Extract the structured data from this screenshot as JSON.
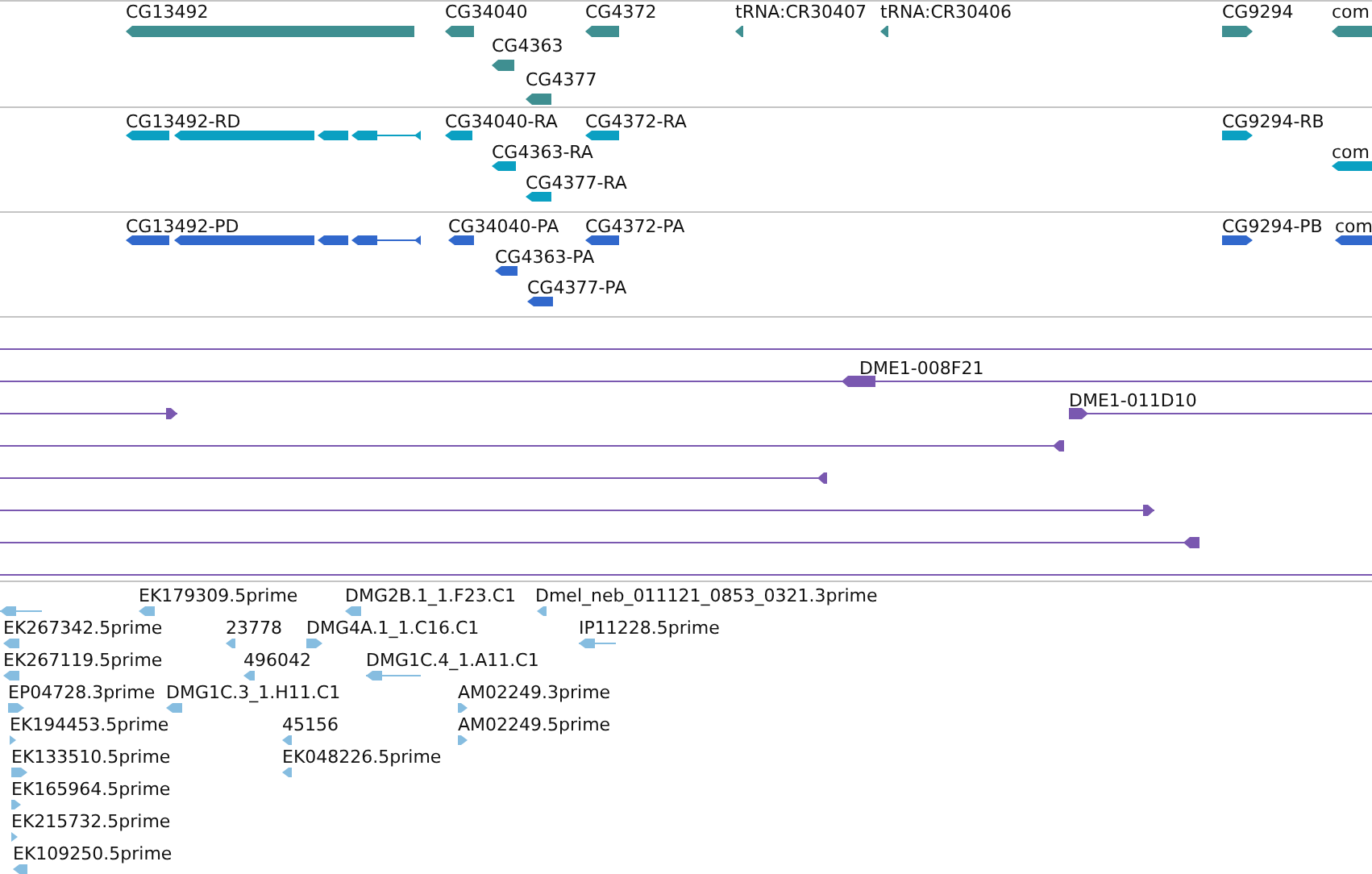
{
  "tracks": [
    {
      "kind": "gene",
      "color": "#3f8f91",
      "features": [
        {
          "label": "CG13492",
          "kind": "reverse"
        },
        {
          "label": "CG34040",
          "kind": "reverse"
        },
        {
          "label": "CG4363",
          "kind": "reverse"
        },
        {
          "label": "CG4372",
          "kind": "reverse"
        },
        {
          "label": "CG4377",
          "kind": "reverse"
        },
        {
          "label": "tRNA:CR30407",
          "kind": "reverse"
        },
        {
          "label": "tRNA:CR30406",
          "kind": "reverse"
        },
        {
          "label": "CG9294",
          "kind": "forward"
        },
        {
          "label": "com",
          "kind": "reverse"
        }
      ]
    },
    {
      "kind": "transcript",
      "color": "#0ba0c2",
      "features": [
        {
          "label": "CG13492-RD",
          "kind": "reverse"
        },
        {
          "label": "CG34040-RA",
          "kind": "reverse"
        },
        {
          "label": "CG4363-RA",
          "kind": "reverse"
        },
        {
          "label": "CG4372-RA",
          "kind": "reverse"
        },
        {
          "label": "CG4377-RA",
          "kind": "reverse"
        },
        {
          "label": "CG9294-RB",
          "kind": "forward"
        },
        {
          "label": "com",
          "kind": "reverse"
        }
      ]
    },
    {
      "kind": "transcript",
      "color": "#3168cc",
      "features": [
        {
          "label": "CG13492-PD",
          "kind": "reverse"
        },
        {
          "label": "CG34040-PA",
          "kind": "reverse"
        },
        {
          "label": "CG4363-PA",
          "kind": "reverse"
        },
        {
          "label": "CG4372-PA",
          "kind": "reverse"
        },
        {
          "label": "CG4377-PA",
          "kind": "reverse"
        },
        {
          "label": "CG9294-PB",
          "kind": "forward"
        },
        {
          "label": "com",
          "kind": "reverse"
        }
      ]
    },
    {
      "kind": "clone",
      "color": "#7a58b0",
      "features": [
        {
          "kind": "plain"
        },
        {
          "label": "DME1-008F21",
          "kind": "reverse"
        },
        {
          "kind": "forward"
        },
        {
          "label": "DME1-011D10",
          "kind": "forward"
        },
        {
          "kind": "reverse"
        },
        {
          "kind": "reverse"
        },
        {
          "kind": "forward"
        },
        {
          "kind": "reverse"
        },
        {
          "kind": "plain"
        }
      ]
    },
    {
      "kind": "est",
      "color": "#86bde0",
      "features": [
        {
          "kind": "reverse"
        },
        {
          "label": "EK179309.5prime",
          "kind": "reverse"
        },
        {
          "label": "DMG2B.1_1.F23.C1",
          "kind": "reverse"
        },
        {
          "label": "Dmel_neb_011121_0853_0321.3prime",
          "kind": "reverse"
        },
        {
          "label": "EK267342.5prime",
          "kind": "reverse"
        },
        {
          "label": "23778",
          "kind": "reverse"
        },
        {
          "label": "DMG4A.1_1.C16.C1",
          "kind": "forward"
        },
        {
          "label": "IP11228.5prime",
          "kind": "reverse"
        },
        {
          "label": "EK267119.5prime",
          "kind": "reverse"
        },
        {
          "label": "496042",
          "kind": "reverse"
        },
        {
          "label": "DMG1C.4_1.A11.C1",
          "kind": "reverse"
        },
        {
          "label": "EP04728.3prime",
          "kind": "forward"
        },
        {
          "label": "DMG1C.3_1.H11.C1",
          "kind": "reverse"
        },
        {
          "label": "AM02249.3prime",
          "kind": "forward"
        },
        {
          "label": "EK194453.5prime",
          "kind": "forward"
        },
        {
          "label": "45156",
          "kind": "reverse"
        },
        {
          "label": "AM02249.5prime",
          "kind": "forward"
        },
        {
          "label": "EK133510.5prime",
          "kind": "forward"
        },
        {
          "label": "EK048226.5prime",
          "kind": "reverse"
        },
        {
          "label": "EK165964.5prime",
          "kind": "forward"
        },
        {
          "label": "EK215732.5prime",
          "kind": "forward"
        },
        {
          "label": "EK109250.5prime",
          "kind": "reverse"
        }
      ]
    }
  ]
}
